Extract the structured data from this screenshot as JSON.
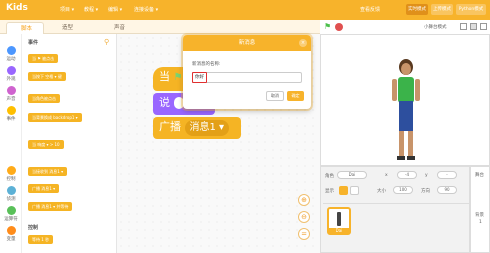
{
  "topbar": {
    "logo": "Kids",
    "menu": [
      "项目 ▾",
      "教程 ▾",
      "编辑 ▾",
      "连接设备 ▾"
    ],
    "right_link": "查看反馈",
    "btn_realtime": "实时模式",
    "btn_upload": "上传模式",
    "btn_python": "Python模式"
  },
  "tabs": {
    "code": "脚本",
    "costume": "造型",
    "sound": "声音"
  },
  "categories": [
    "运动",
    "外观",
    "声音",
    "事件",
    "控制",
    "侦测",
    "运算符",
    "变量"
  ],
  "palette": {
    "section_events": "事件",
    "blocks": [
      "当 ⚑ 被点击",
      "当按下 空格 ▾ 键",
      "当角色被点击",
      "当背景换成 backdrop1 ▾",
      "当 响度 ▾ > 10",
      "当接收到 消息1 ▾",
      "广播 消息1 ▾",
      "广播 消息1 ▾ 并等待"
    ],
    "section_control": "控制",
    "control_block": "等待 1 秒"
  },
  "scripts": {
    "block1": "当",
    "block2": "说",
    "block3_prefix": "广播",
    "block3_msg": "消息1 ▾"
  },
  "modal": {
    "title": "新消息",
    "close": "×",
    "label": "新消息的名称:",
    "input_value": "你好",
    "cancel": "取消",
    "ok": "确定"
  },
  "stagebar": {
    "mode_label": "小舞台模式"
  },
  "sprite_panel": {
    "sprite_label": "角色",
    "sprite_name": "Dai",
    "x_label": "x",
    "x_value": "-4",
    "y_label": "y",
    "y_value": "-",
    "show_label": "显示",
    "size_label": "大小",
    "size_value": "100",
    "direction_label": "方向",
    "direction_value": "90",
    "thumb_label": "Dai"
  },
  "stage_panel": {
    "label": "舞台",
    "backdrop_label": "背景",
    "backdrop_count": "1"
  },
  "colors": {
    "brand": "#f7b32b",
    "event": "#f5b424",
    "looks": "#9966ff"
  }
}
